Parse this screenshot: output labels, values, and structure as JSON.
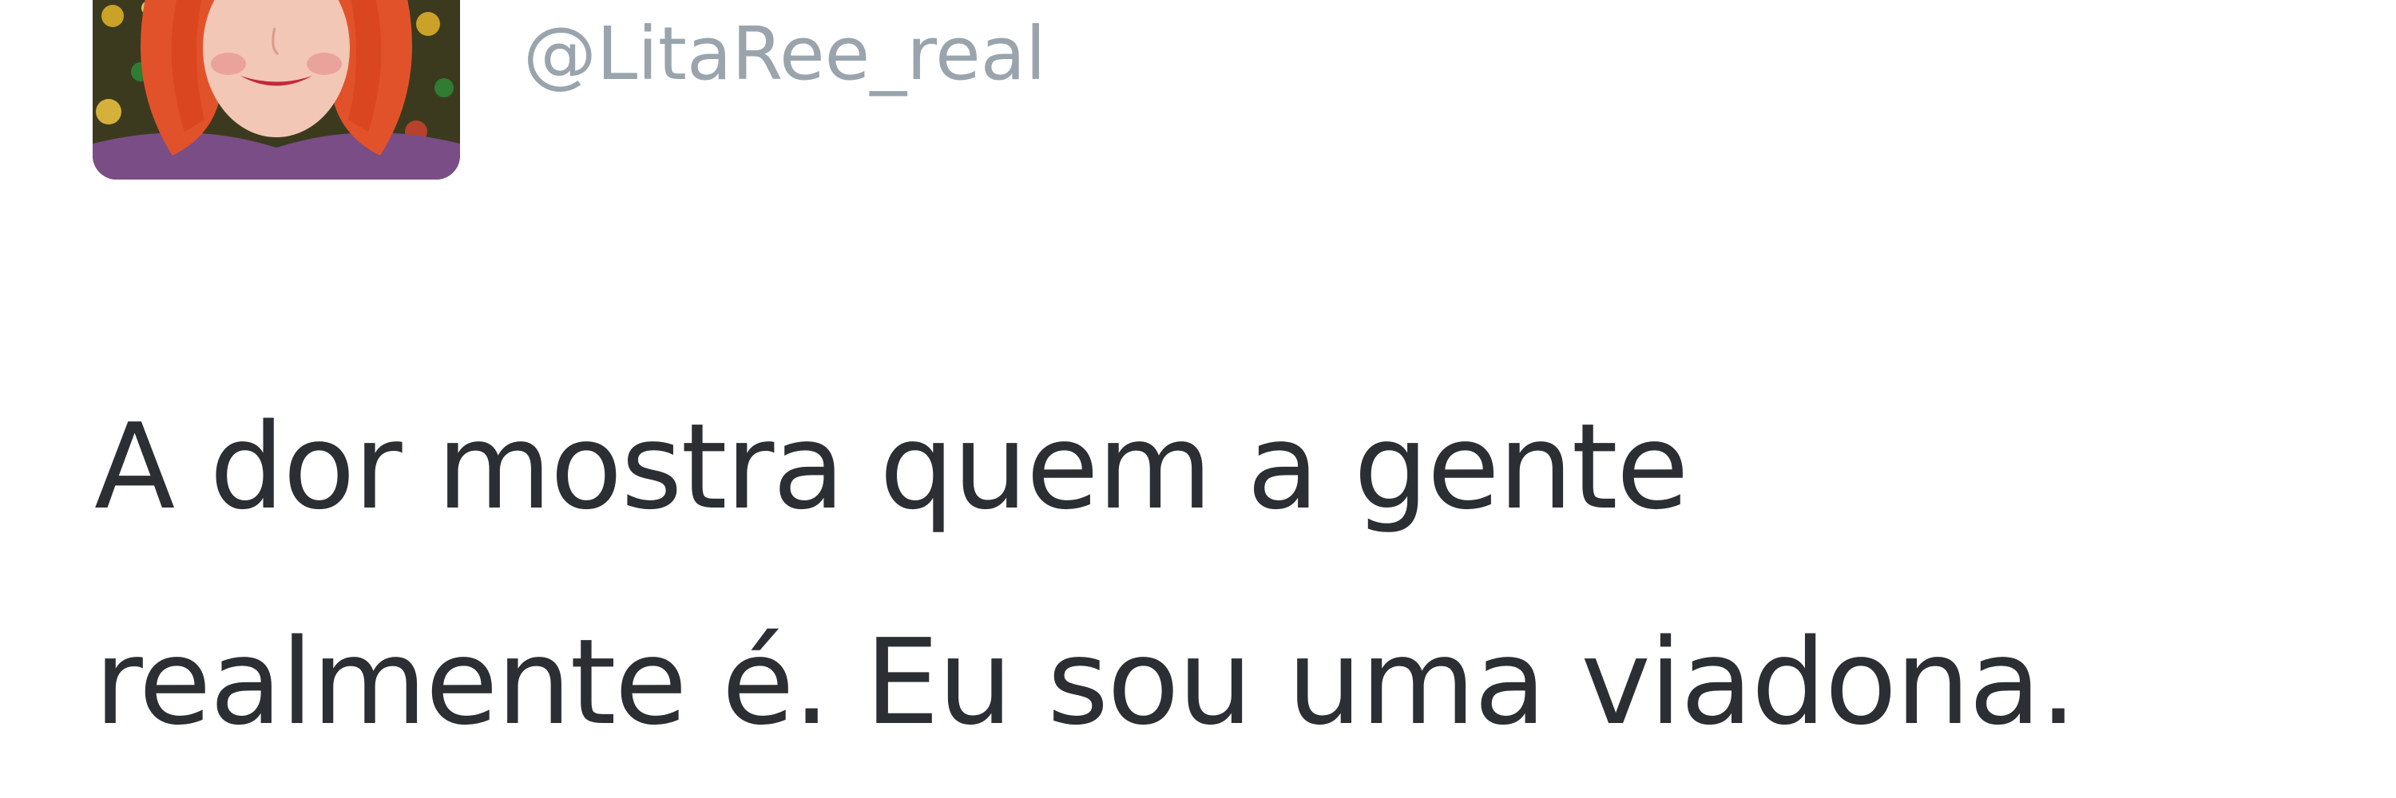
{
  "tweet": {
    "handle": "@LitaRee_real",
    "avatar_icon": "profile-avatar-icon",
    "text_lines": [
      "A dor mostra quem a gente",
      "realmente é. Eu sou uma viadona."
    ]
  },
  "colors": {
    "background": "#ffffff",
    "handle": "#9aa4ad",
    "text": "#2b2f33"
  }
}
